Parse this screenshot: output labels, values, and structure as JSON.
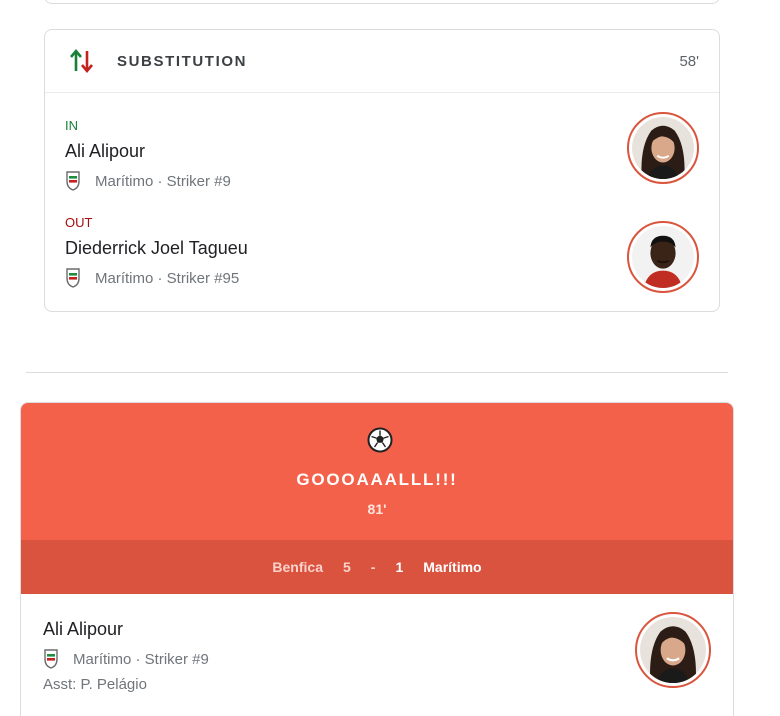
{
  "substitution": {
    "title": "SUBSTITUTION",
    "minute": "58'",
    "in": {
      "label": "IN",
      "name": "Ali Alipour",
      "meta": "Marítimo · Striker #9"
    },
    "out": {
      "label": "OUT",
      "name": "Diederrick Joel Tagueu",
      "meta": "Marítimo · Striker #95"
    }
  },
  "goal": {
    "headline": "GOOOAAALLL!!!",
    "minute": "81'",
    "score": {
      "home_team": "Benfica",
      "home_score": "5",
      "separator": "-",
      "away_score": "1",
      "away_team": "Marítimo"
    },
    "scorer": {
      "name": "Ali Alipour",
      "meta": "Marítimo · Striker #9",
      "assist": "Asst: P. Pelágio"
    }
  },
  "colors": {
    "goal_banner": "#f4614a",
    "score_bar": "#d9533f",
    "in_label": "#188038",
    "out_label": "#a50e0e",
    "avatar_ring": "#d9553d"
  },
  "icons": {
    "substitution": "swap-arrows-icon",
    "club": "maritimo-crest-icon",
    "goal": "soccer-ball-icon"
  }
}
